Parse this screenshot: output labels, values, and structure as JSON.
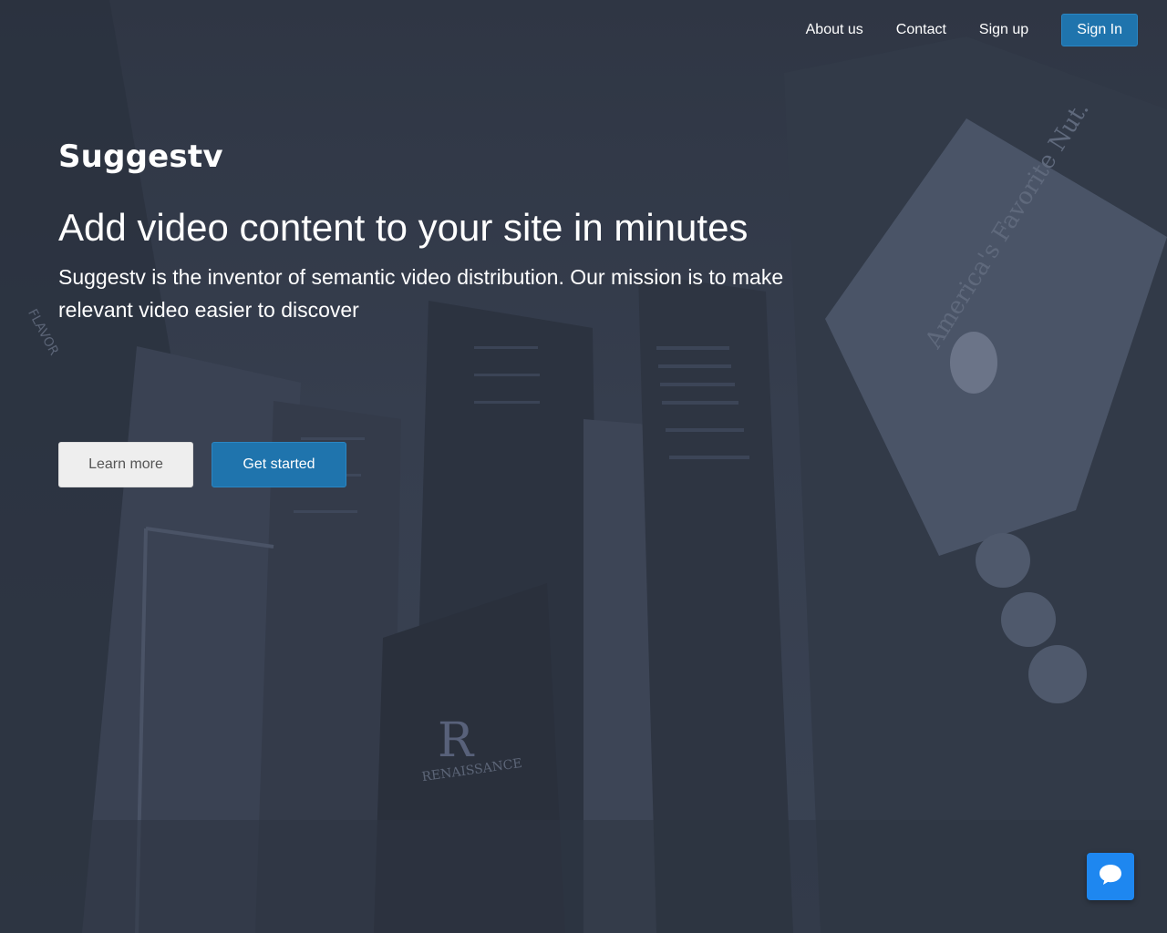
{
  "nav": {
    "about": "About us",
    "contact": "Contact",
    "signup": "Sign up",
    "signin": "Sign In"
  },
  "hero": {
    "brand": "Suggestv",
    "headline": "Add video content to your site in minutes",
    "subline": "Suggestv is the inventor of semantic video distribution. Our mission is to make relevant video easier to discover",
    "learn_more": "Learn more",
    "get_started": "Get started"
  },
  "background_signage": {
    "billboard": "America's Favorite Nut.",
    "hotel": "RENAISSANCE",
    "flavor": "FLAVOR"
  },
  "chat": {
    "icon": "chat-bubble-icon"
  },
  "colors": {
    "accent": "#1f74ad",
    "chat": "#1e87f0",
    "overlay": "#353d4d"
  }
}
